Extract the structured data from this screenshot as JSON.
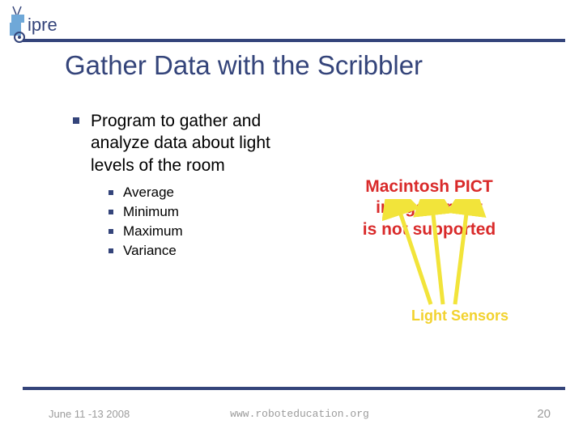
{
  "brand": {
    "name": "ipre"
  },
  "title": "Gather Data with the Scribbler",
  "content": {
    "main_bullet": "Program to gather and analyze data about light levels of the room",
    "sub_bullets": [
      "Average",
      "Minimum",
      "Maximum",
      "Variance"
    ]
  },
  "pict_error": {
    "line1": "Macintosh PICT",
    "line2": "image format",
    "line3": "is not supported"
  },
  "annotation": "Light Sensors",
  "footer": {
    "date": "June 11 -13 2008",
    "url": "www.roboteducation.org",
    "page": "20"
  },
  "colors": {
    "brand_blue": "#34447a",
    "arrow_yellow": "#f2e43a",
    "error_red": "#d92a2a",
    "footer_gray": "#9c9c9c"
  }
}
